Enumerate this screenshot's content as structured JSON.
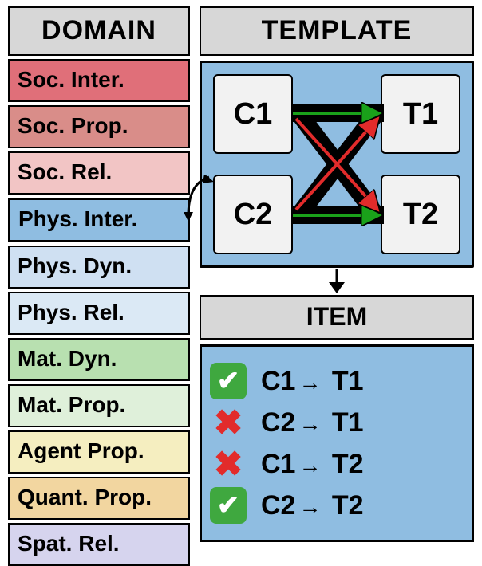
{
  "domain": {
    "header": "DOMAIN",
    "items": [
      {
        "label": "Soc. Inter.",
        "bg": "#e06f79",
        "active": false
      },
      {
        "label": "Soc. Prop.",
        "bg": "#d98d89",
        "active": false
      },
      {
        "label": "Soc. Rel.",
        "bg": "#f2c5c5",
        "active": false
      },
      {
        "label": "Phys. Inter.",
        "bg": "#8fbde1",
        "active": true
      },
      {
        "label": "Phys. Dyn.",
        "bg": "#cfe0f2",
        "active": false
      },
      {
        "label": "Phys. Rel.",
        "bg": "#dbe9f5",
        "active": false
      },
      {
        "label": "Mat. Dyn.",
        "bg": "#b8e0b0",
        "active": false
      },
      {
        "label": "Mat. Prop.",
        "bg": "#dff0da",
        "active": false
      },
      {
        "label": "Agent Prop.",
        "bg": "#f5eec0",
        "active": false
      },
      {
        "label": "Quant. Prop.",
        "bg": "#f2d6a0",
        "active": false
      },
      {
        "label": "Spat. Rel.",
        "bg": "#d6d4ee",
        "active": false
      }
    ]
  },
  "template": {
    "header": "TEMPLATE",
    "nodes": {
      "c1": "C1",
      "c2": "C2",
      "t1": "T1",
      "t2": "T2"
    },
    "edges": [
      {
        "from": "C1",
        "to": "T1",
        "correct": true
      },
      {
        "from": "C2",
        "to": "T2",
        "correct": true
      },
      {
        "from": "C1",
        "to": "T2",
        "correct": false
      },
      {
        "from": "C2",
        "to": "T1",
        "correct": false
      }
    ]
  },
  "item": {
    "header": "ITEM",
    "mappings": [
      {
        "valid": true,
        "from": "C1",
        "to": "T1"
      },
      {
        "valid": false,
        "from": "C2",
        "to": "T1"
      },
      {
        "valid": false,
        "from": "C1",
        "to": "T2"
      },
      {
        "valid": true,
        "from": "C2",
        "to": "T2"
      }
    ]
  },
  "glyphs": {
    "check": "✔",
    "cross": "✖",
    "rarrow": "→"
  }
}
